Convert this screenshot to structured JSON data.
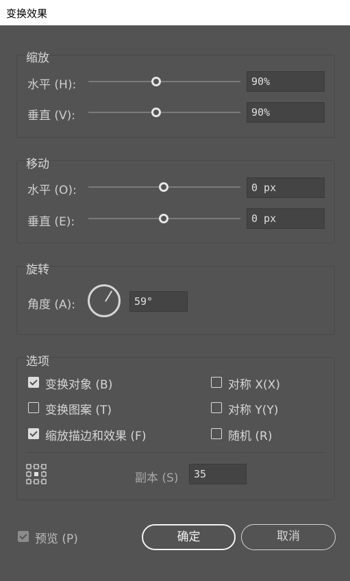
{
  "window": {
    "title": "变换效果"
  },
  "scale": {
    "title": "缩放",
    "horizontal": {
      "label": "水平 (H):",
      "value": "90%",
      "slider_percent": 90
    },
    "vertical": {
      "label": "垂直 (V):",
      "value": "90%",
      "slider_percent": 90
    }
  },
  "move": {
    "title": "移动",
    "horizontal": {
      "label": "水平 (O):",
      "value": "0 px"
    },
    "vertical": {
      "label": "垂直 (E):",
      "value": "0 px"
    }
  },
  "rotate": {
    "title": "旋转",
    "angle_label": "角度 (A):",
    "angle_value": "59°",
    "angle_degrees": 59
  },
  "options": {
    "title": "选项",
    "transform_objects": {
      "label": "变换对象 (B)",
      "checked": true
    },
    "transform_patterns": {
      "label": "变换图案 (T)",
      "checked": false
    },
    "scale_strokes": {
      "label": "缩放描边和效果 (F)",
      "checked": true
    },
    "reflect_x": {
      "label": "对称 X(X)",
      "checked": false
    },
    "reflect_y": {
      "label": "对称 Y(Y)",
      "checked": false
    },
    "random": {
      "label": "随机 (R)",
      "checked": false
    },
    "copies_label": "副本 (S)",
    "copies_value": "35"
  },
  "footer": {
    "preview": {
      "label": "预览 (P)",
      "checked": true
    },
    "ok_label": "确定",
    "cancel_label": "取消"
  }
}
